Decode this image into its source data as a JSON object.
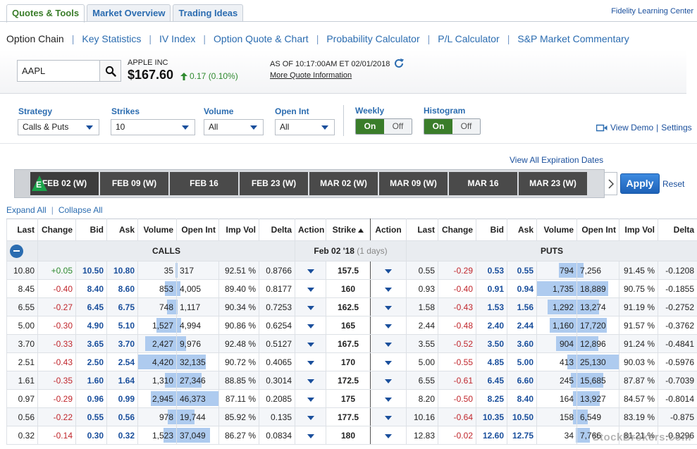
{
  "top_tabs": [
    "Quotes & Tools",
    "Market Overview",
    "Trading Ideas"
  ],
  "learning_link": "Fidelity Learning Center",
  "subnav": [
    "Option Chain",
    "Key Statistics",
    "IV Index",
    "Option Quote & Chart",
    "Probability Calculator",
    "P/L Calculator",
    "S&P Market Commentary"
  ],
  "quote": {
    "symbol": "AAPL",
    "company": "APPLE INC",
    "price": "$167.60",
    "change": "0.17 (0.10%)",
    "asof": "AS OF 10:17:00AM ET 02/01/2018",
    "more_link": "More Quote Information"
  },
  "filters": {
    "strategy_label": "Strategy",
    "strategy_value": "Calls & Puts",
    "strikes_label": "Strikes",
    "strikes_value": "10",
    "volume_label": "Volume",
    "volume_value": "All",
    "openint_label": "Open Int",
    "openint_value": "All",
    "weekly_label": "Weekly",
    "histogram_label": "Histogram",
    "on": "On",
    "off": "Off",
    "view_demo": "View Demo",
    "divider": "|",
    "settings": "Settings"
  },
  "expirations": {
    "view_all": "View All Expiration Dates",
    "e_badge": "E",
    "items": [
      "FEB 02 (W)",
      "FEB 09 (W)",
      "FEB 16",
      "FEB 23 (W)",
      "MAR 02 (W)",
      "MAR 09 (W)",
      "MAR 16",
      "MAR 23 (W)"
    ],
    "apply": "Apply",
    "reset": "Reset"
  },
  "expand_all": "Expand All",
  "collapse_all": "Collapse All",
  "table": {
    "headers": [
      "Last",
      "Change",
      "Bid",
      "Ask",
      "Volume",
      "Open Int",
      "Imp Vol",
      "Delta",
      "Action",
      "Strike",
      "Action",
      "Last",
      "Change",
      "Bid",
      "Ask",
      "Volume",
      "Open Int",
      "Imp Vol",
      "Delta"
    ],
    "calls_label": "CALLS",
    "puts_label": "PUTS",
    "date_label": "Feb 02 '18",
    "days_label": "(1 days)",
    "rows": [
      {
        "c_last": "10.80",
        "c_chg": "+0.05",
        "c_bid": "10.50",
        "c_ask": "10.80",
        "c_vol": "35",
        "c_vol_f": 0.01,
        "c_oi": "317",
        "c_oi_f": 0.01,
        "c_iv": "92.51 %",
        "c_delta": "0.8766",
        "strike": "157.5",
        "p_last": "0.55",
        "p_chg": "-0.29",
        "p_bid": "0.53",
        "p_ask": "0.55",
        "p_vol": "794",
        "p_vol_f": 0.45,
        "p_oi": "7,256",
        "p_oi_f": 0.16
      },
      {
        "c_last": "8.45",
        "c_chg": "-0.40",
        "c_bid": "8.40",
        "c_ask": "8.60",
        "c_vol": "853",
        "c_vol_f": 0.29,
        "c_oi": "4,005",
        "c_oi_f": 0.09,
        "c_iv": "89.40 %",
        "c_delta": "0.8177",
        "strike": "160",
        "p_last": "0.93",
        "p_chg": "-0.40",
        "p_bid": "0.91",
        "p_ask": "0.94",
        "p_vol": "1,735",
        "p_vol_f": 1.0,
        "p_oi": "18,889",
        "p_oi_f": 0.75
      },
      {
        "c_last": "6.55",
        "c_chg": "-0.27",
        "c_bid": "6.45",
        "c_ask": "6.75",
        "c_vol": "748",
        "c_vol_f": 0.25,
        "c_oi": "1,117",
        "c_oi_f": 0.02,
        "c_iv": "90.34 %",
        "c_delta": "0.7253",
        "strike": "162.5",
        "p_last": "1.58",
        "p_chg": "-0.43",
        "p_bid": "1.53",
        "p_ask": "1.56",
        "p_vol": "1,292",
        "p_vol_f": 0.74,
        "p_oi": "13,274",
        "p_oi_f": 0.53
      },
      {
        "c_last": "5.00",
        "c_chg": "-0.30",
        "c_bid": "4.90",
        "c_ask": "5.10",
        "c_vol": "1,527",
        "c_vol_f": 0.52,
        "c_oi": "4,994",
        "c_oi_f": 0.11,
        "c_iv": "90.86 %",
        "c_delta": "0.6254",
        "strike": "165",
        "p_last": "2.44",
        "p_chg": "-0.48",
        "p_bid": "2.40",
        "p_ask": "2.44",
        "p_vol": "1,160",
        "p_vol_f": 0.67,
        "p_oi": "17,720",
        "p_oi_f": 0.71
      },
      {
        "c_last": "3.70",
        "c_chg": "-0.33",
        "c_bid": "3.65",
        "c_ask": "3.70",
        "c_vol": "2,427",
        "c_vol_f": 0.82,
        "c_oi": "9,976",
        "c_oi_f": 0.22,
        "c_iv": "92.48 %",
        "c_delta": "0.5127",
        "strike": "167.5",
        "p_last": "3.55",
        "p_chg": "-0.52",
        "p_bid": "3.50",
        "p_ask": "3.60",
        "p_vol": "904",
        "p_vol_f": 0.52,
        "p_oi": "12,896",
        "p_oi_f": 0.51
      },
      {
        "c_last": "2.51",
        "c_chg": "-0.43",
        "c_bid": "2.50",
        "c_ask": "2.54",
        "c_vol": "4,420",
        "c_vol_f": 1.0,
        "c_oi": "32,135",
        "c_oi_f": 0.69,
        "c_iv": "90.72 %",
        "c_delta": "0.4065",
        "strike": "170",
        "p_last": "5.00",
        "p_chg": "-0.55",
        "p_bid": "4.85",
        "p_ask": "5.00",
        "p_vol": "413",
        "p_vol_f": 0.24,
        "p_oi": "25,130",
        "p_oi_f": 1.0
      },
      {
        "c_last": "1.61",
        "c_chg": "-0.35",
        "c_bid": "1.60",
        "c_ask": "1.64",
        "c_vol": "1,310",
        "c_vol_f": 0.3,
        "c_oi": "27,346",
        "c_oi_f": 0.59,
        "c_iv": "88.85 %",
        "c_delta": "0.3014",
        "strike": "172.5",
        "p_last": "6.55",
        "p_chg": "-0.61",
        "p_bid": "6.45",
        "p_ask": "6.60",
        "p_vol": "245",
        "p_vol_f": 0.14,
        "p_oi": "15,685",
        "p_oi_f": 0.62
      },
      {
        "c_last": "0.97",
        "c_chg": "-0.29",
        "c_bid": "0.96",
        "c_ask": "0.99",
        "c_vol": "2,945",
        "c_vol_f": 0.67,
        "c_oi": "46,373",
        "c_oi_f": 1.0,
        "c_iv": "87.11 %",
        "c_delta": "0.2085",
        "strike": "175",
        "p_last": "8.20",
        "p_chg": "-0.50",
        "p_bid": "8.25",
        "p_ask": "8.40",
        "p_vol": "164",
        "p_vol_f": 0.09,
        "p_oi": "13,927",
        "p_oi_f": 0.55
      },
      {
        "c_last": "0.56",
        "c_chg": "-0.22",
        "c_bid": "0.55",
        "c_ask": "0.56",
        "c_vol": "978",
        "c_vol_f": 0.22,
        "c_oi": "19,744",
        "c_oi_f": 0.43,
        "c_iv": "85.92 %",
        "c_delta": "0.135",
        "strike": "177.5",
        "p_last": "10.16",
        "p_chg": "-0.64",
        "p_bid": "10.35",
        "p_ask": "10.50",
        "p_vol": "158",
        "p_vol_f": 0.09,
        "p_oi": "6,549",
        "p_oi_f": 0.26
      },
      {
        "c_last": "0.32",
        "c_chg": "-0.14",
        "c_bid": "0.30",
        "c_ask": "0.32",
        "c_vol": "1,523",
        "c_vol_f": 0.34,
        "c_oi": "37,049",
        "c_oi_f": 0.8,
        "c_iv": "86.27 %",
        "c_delta": "0.0834",
        "strike": "180",
        "p_last": "12.83",
        "p_chg": "-0.02",
        "p_bid": "12.60",
        "p_ask": "12.75",
        "p_vol": "34",
        "p_vol_f": 0.02,
        "p_oi": "7,766",
        "p_oi_f": 0.31
      }
    ],
    "put_tail": [
      {
        "iv": "91.45 %",
        "delta": "-0.1208"
      },
      {
        "iv": "90.75 %",
        "delta": "-0.1855"
      },
      {
        "iv": "91.19 %",
        "delta": "-0.2752"
      },
      {
        "iv": "91.57 %",
        "delta": "-0.3762"
      },
      {
        "iv": "91.24 %",
        "delta": "-0.4841"
      },
      {
        "iv": "90.03 %",
        "delta": "-0.5976"
      },
      {
        "iv": "87.87 %",
        "delta": "-0.7039"
      },
      {
        "iv": "84.57 %",
        "delta": "-0.8014"
      },
      {
        "iv": "83.19 %",
        "delta": "-0.875"
      },
      {
        "iv": "81.21 %",
        "delta": "-0.9296"
      }
    ]
  },
  "watermark": "StockBrokers.com",
  "colors": {
    "green": "#3a7d2a",
    "blue": "#2b6cb0",
    "red": "#c0262c",
    "bar": "#aecbef"
  }
}
